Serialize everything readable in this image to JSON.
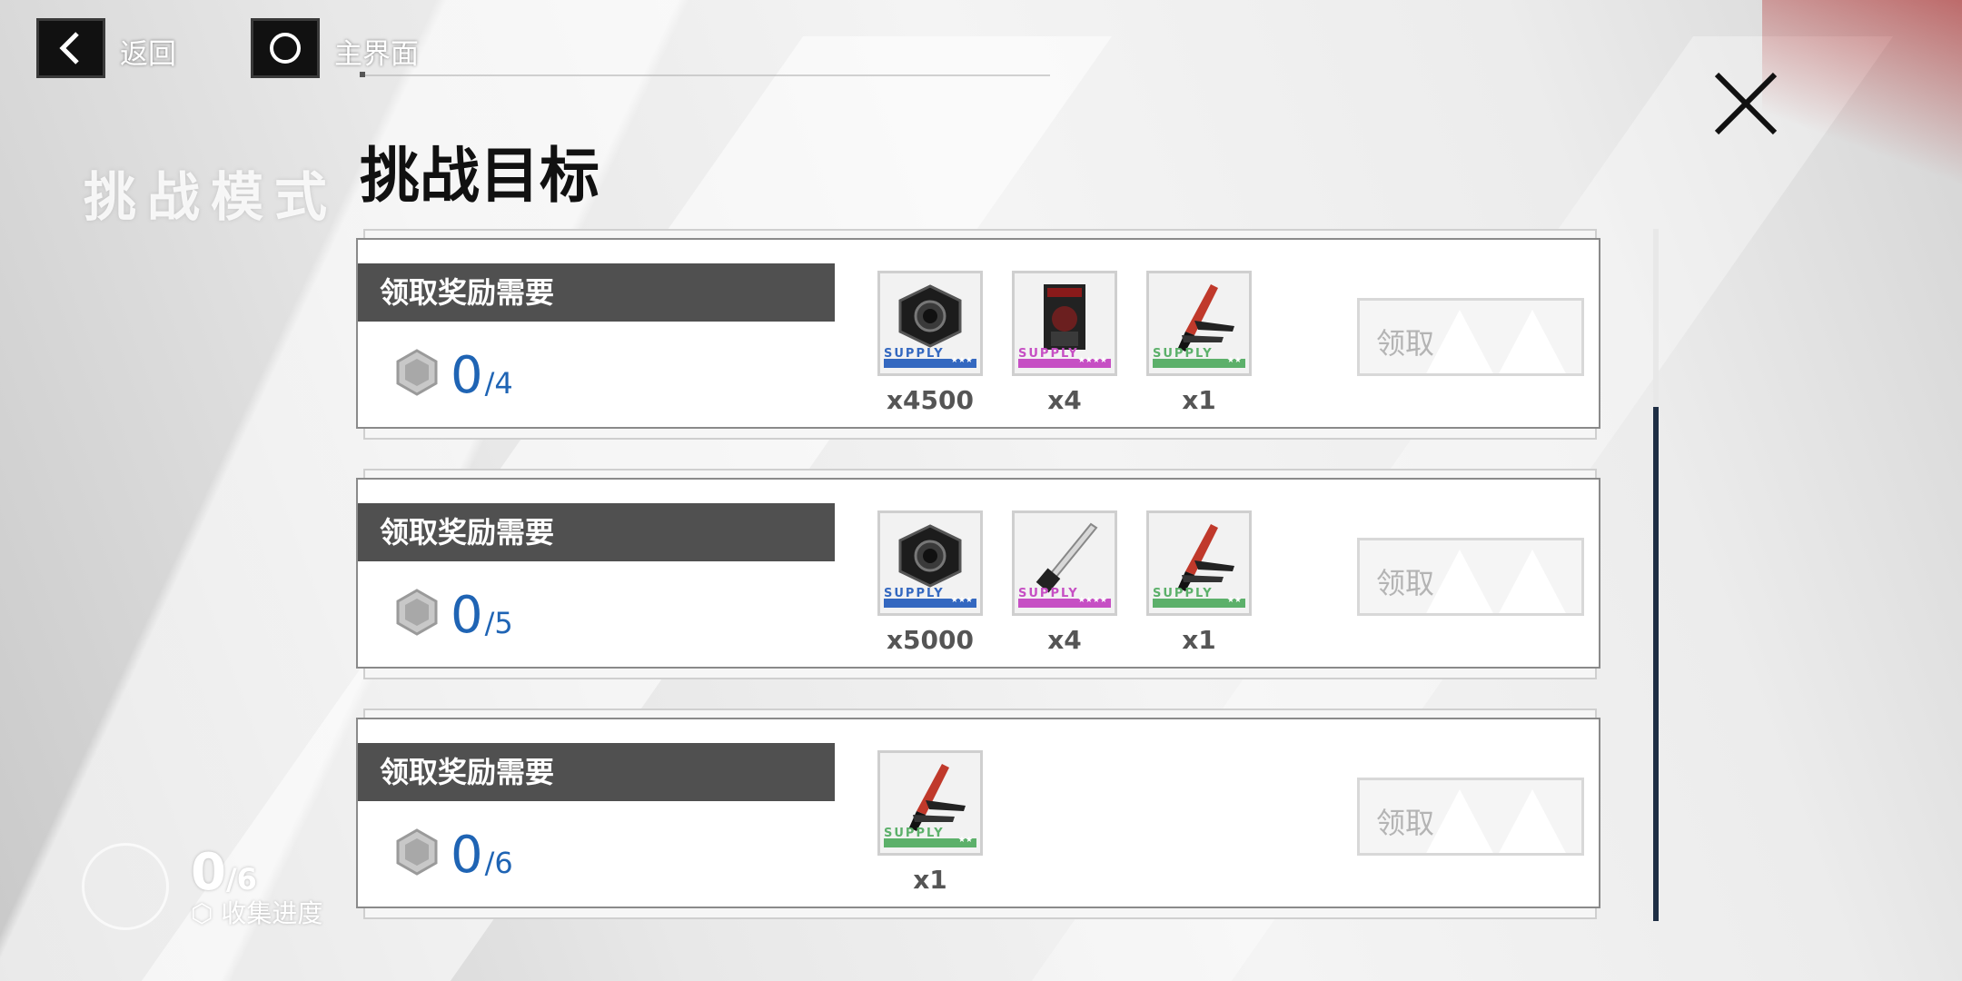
{
  "nav": {
    "back_label": "返回",
    "home_label": "主界面"
  },
  "header": {
    "ghost_title": "挑战模式",
    "title": "挑战目标"
  },
  "cards": [
    {
      "requirement_label": "领取奖励需要",
      "progress_current": "0",
      "progress_total": "/4",
      "claim_label": "领取",
      "items": [
        {
          "icon": "hex-nut-icon",
          "supply": "SUPPLY",
          "stars": "★★★",
          "rarity_color": "#3468c0",
          "count": "x4500"
        },
        {
          "icon": "data-card-icon",
          "supply": "SUPPLY",
          "stars": "★★★★",
          "rarity_color": "#c64fc4",
          "count": "x4"
        },
        {
          "icon": "combat-knife-icon",
          "supply": "SUPPLY",
          "stars": "★★",
          "rarity_color": "#5cb06a",
          "count": "x1"
        }
      ]
    },
    {
      "requirement_label": "领取奖励需要",
      "progress_current": "0",
      "progress_total": "/5",
      "claim_label": "领取",
      "items": [
        {
          "icon": "hex-nut-icon",
          "supply": "SUPPLY",
          "stars": "★★★",
          "rarity_color": "#3468c0",
          "count": "x5000"
        },
        {
          "icon": "blade-icon",
          "supply": "SUPPLY",
          "stars": "★★★★",
          "rarity_color": "#c64fc4",
          "count": "x4"
        },
        {
          "icon": "combat-knife-icon",
          "supply": "SUPPLY",
          "stars": "★★",
          "rarity_color": "#5cb06a",
          "count": "x1"
        }
      ]
    },
    {
      "requirement_label": "领取奖励需要",
      "progress_current": "0",
      "progress_total": "/6",
      "claim_label": "领取",
      "items": [
        {
          "icon": "combat-knife-icon",
          "supply": "SUPPLY",
          "stars": "★★",
          "rarity_color": "#5cb06a",
          "count": "x1"
        }
      ]
    }
  ],
  "collection": {
    "current": "0",
    "total": "/6",
    "label": "收集进度"
  }
}
